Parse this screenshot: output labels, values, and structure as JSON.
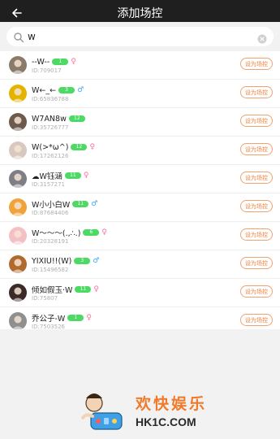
{
  "header": {
    "title": "添加场控",
    "back_icon": "arrow-left-icon"
  },
  "search": {
    "value": "w",
    "placeholder": ""
  },
  "rows": [
    {
      "name": "--W--",
      "level": "1",
      "gender": "♀",
      "gender_type": "f",
      "id": "ID:709017",
      "button": "设为场控",
      "avatar_color": "#8a7a6a"
    },
    {
      "name": "W←_←",
      "level": "3",
      "gender": "♂",
      "gender_type": "m",
      "id": "ID:65836788",
      "button": "设为场控",
      "avatar_color": "#e2b400"
    },
    {
      "name": "W7AN8w",
      "level": "12",
      "gender": "",
      "gender_type": "",
      "id": "ID:35726777",
      "button": "设为场控",
      "avatar_color": "#6d5a4d"
    },
    {
      "name": "W(>*ω^)",
      "level": "12",
      "gender": "♀",
      "gender_type": "f",
      "id": "ID:17262126",
      "button": "设为场控",
      "avatar_color": "#d8c8c0"
    },
    {
      "name": "☁W钰涵",
      "level": "11",
      "gender": "♀",
      "gender_type": "f",
      "id": "ID:3157271",
      "button": "设为场控",
      "avatar_color": "#7d7f85"
    },
    {
      "name": "W小小白W",
      "level": "11",
      "gender": "♂",
      "gender_type": "m",
      "id": "ID:87684406",
      "button": "设为场控",
      "avatar_color": "#f0a33a"
    },
    {
      "name": "W～～～(.,∴.)",
      "level": "6",
      "gender": "♀",
      "gender_type": "f",
      "id": "ID:20328191",
      "button": "设为场控",
      "avatar_color": "#f3c1c5"
    },
    {
      "name": "YIXIU!!(W)",
      "level": "3",
      "gender": "♂",
      "gender_type": "m",
      "id": "ID:15496582",
      "button": "设为场控",
      "avatar_color": "#b06a2e"
    },
    {
      "name": "倾如假玉·W",
      "level": "11",
      "gender": "♀",
      "gender_type": "f",
      "id": "ID:75807",
      "button": "设为场控",
      "avatar_color": "#3b2a28"
    },
    {
      "name": "乔公子-W",
      "level": "1",
      "gender": "♀",
      "gender_type": "f",
      "id": "ID:7503526",
      "button": "设为场控",
      "avatar_color": "#8f8f8f"
    }
  ],
  "watermark": {
    "cn": "欢快娱乐",
    "en": "HK1C.COM"
  }
}
